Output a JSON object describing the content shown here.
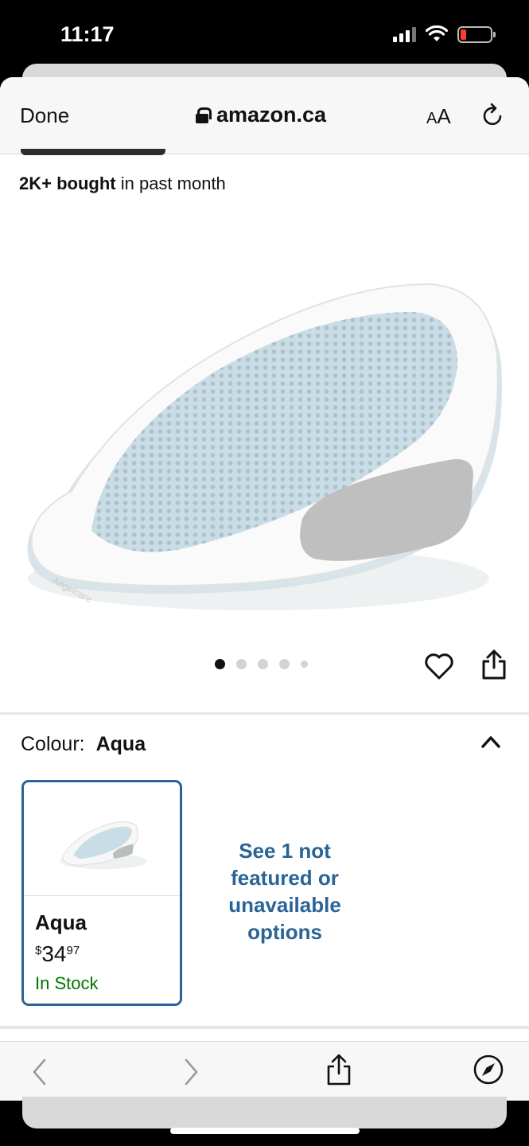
{
  "status_bar": {
    "time": "11:17",
    "icons": [
      "cellular-signal-icon",
      "wifi-icon",
      "battery-low-icon"
    ]
  },
  "browser": {
    "done_label": "Done",
    "domain": "amazon.ca",
    "text_size_label_small": "A",
    "text_size_label_large": "A",
    "icons": [
      "lock-icon",
      "reload-icon"
    ]
  },
  "product": {
    "bought_bold": "2K+ bought",
    "bought_rest": " in past month",
    "image_icon": "baby-bath-seat-image",
    "gallery_dots_count": 5,
    "gallery_active_index": 0
  },
  "actions": {
    "icons": [
      "heart-icon",
      "share-icon"
    ]
  },
  "variant": {
    "label": "Colour:",
    "value": "Aqua",
    "swatch": {
      "name": "Aqua",
      "price_symbol": "$",
      "price_whole": "34",
      "price_fraction": "97",
      "stock": "In Stock"
    },
    "see_more": "See 1 not featured or unavailable options"
  },
  "bottom_toolbar": {
    "icons": [
      "back-icon",
      "forward-icon",
      "share-icon",
      "compass-icon"
    ]
  },
  "colors": {
    "link_blue": "#2a6496",
    "in_stock_green": "#007600",
    "selected_border": "#2a6496",
    "battery_red": "#ff3b30"
  }
}
